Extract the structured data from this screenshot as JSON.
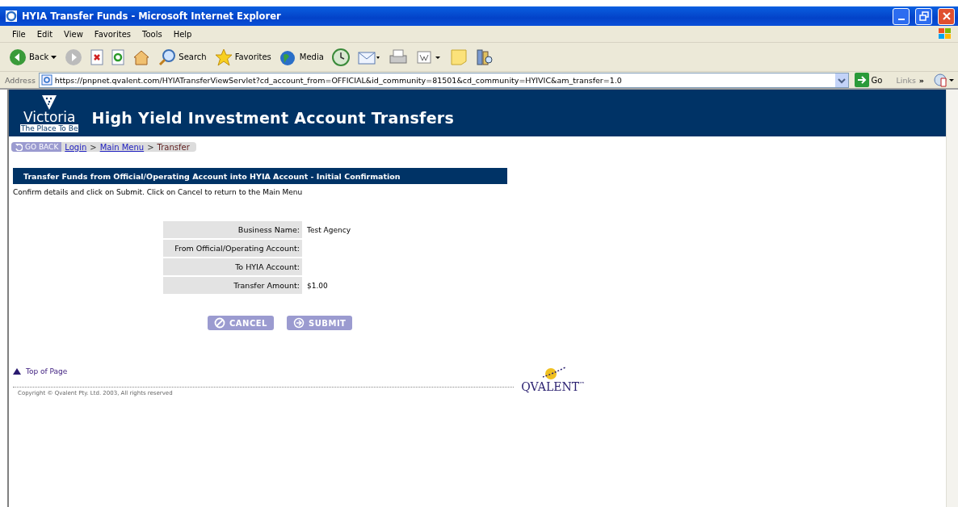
{
  "window": {
    "title": "HYIA Transfer Funds - Microsoft Internet Explorer"
  },
  "menu": [
    "File",
    "Edit",
    "View",
    "Favorites",
    "Tools",
    "Help"
  ],
  "toolbar": [
    {
      "kind": "back",
      "label": "Back"
    },
    {
      "kind": "forward"
    },
    {
      "kind": "stop"
    },
    {
      "kind": "refresh"
    },
    {
      "kind": "home"
    },
    {
      "kind": "search",
      "label": "Search"
    },
    {
      "kind": "favorites",
      "label": "Favorites"
    },
    {
      "kind": "media",
      "label": "Media"
    },
    {
      "kind": "history"
    },
    {
      "kind": "mail"
    },
    {
      "kind": "print"
    },
    {
      "kind": "edit"
    },
    {
      "kind": "notes"
    },
    {
      "kind": "research"
    }
  ],
  "address": {
    "label": "Address",
    "url": "https://pnpnet.qvalent.com/HYIATransferViewServlet?cd_account_from=OFFICIAL&id_community=81501&cd_community=HYIVIC&am_transfer=1.0",
    "go": "Go",
    "links": "Links",
    "more": "»"
  },
  "header": {
    "logo_top": "Victoria",
    "logo_bottom": "The Place To Be",
    "title": "High Yield Investment Account Transfers"
  },
  "breadcrumb": {
    "back": "GO BACK",
    "items": [
      {
        "label": "Login",
        "kind": "link"
      },
      {
        "label": "Main Menu",
        "kind": "link"
      },
      {
        "label": "Transfer",
        "kind": "current"
      }
    ],
    "separator": ">"
  },
  "section_title": "Transfer Funds from Official/Operating Account into HYIA Account - Initial Confirmation",
  "instruction": "Confirm details and click on Submit. Click on Cancel to return to the Main Menu",
  "details": [
    {
      "label": "Business Name:",
      "value": "Test Agency"
    },
    {
      "label": "From Official/Operating Account:"
    },
    {
      "label": "To HYIA Account:"
    },
    {
      "label": "Transfer Amount:",
      "value": "$1.00"
    }
  ],
  "buttons": [
    {
      "kind": "cancel",
      "label": "CANCEL"
    },
    {
      "kind": "submit",
      "label": "SUBMIT"
    }
  ],
  "footer": {
    "top_of_page": "Top of Page",
    "copyright": "Copyright © Qvalent Pty. Ltd. 2003, All rights reserved",
    "logo": "QVALENT",
    "trademark": "™"
  }
}
